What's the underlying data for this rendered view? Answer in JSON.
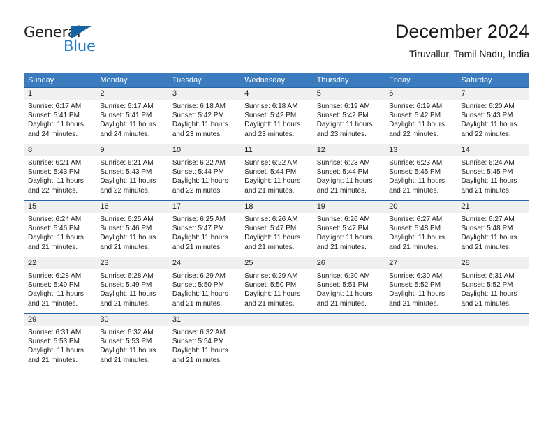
{
  "brand": {
    "name_top": "General",
    "name_bottom": "Blue",
    "triangle_color": "#1464a5",
    "blue_text_color": "#1f7ac4"
  },
  "header": {
    "title": "December 2024",
    "subtitle": "Tiruvallur, Tamil Nadu, India"
  },
  "theme": {
    "header_bg": "#3a7cbe",
    "header_text": "#ffffff",
    "week_rule": "#2166ab",
    "number_strip_bg": "#f0f0f0",
    "page_bg": "#ffffff",
    "text": "#1a1a1a"
  },
  "weekdays": [
    "Sunday",
    "Monday",
    "Tuesday",
    "Wednesday",
    "Thursday",
    "Friday",
    "Saturday"
  ],
  "labels": {
    "sunrise_prefix": "Sunrise:",
    "sunset_prefix": "Sunset:",
    "daylight_prefix": "Daylight:"
  },
  "weeks": [
    {
      "days": [
        {
          "num": "1",
          "sunrise": "Sunrise: 6:17 AM",
          "sunset": "Sunset: 5:41 PM",
          "daylight1": "Daylight: 11 hours",
          "daylight2": "and 24 minutes."
        },
        {
          "num": "2",
          "sunrise": "Sunrise: 6:17 AM",
          "sunset": "Sunset: 5:41 PM",
          "daylight1": "Daylight: 11 hours",
          "daylight2": "and 24 minutes."
        },
        {
          "num": "3",
          "sunrise": "Sunrise: 6:18 AM",
          "sunset": "Sunset: 5:42 PM",
          "daylight1": "Daylight: 11 hours",
          "daylight2": "and 23 minutes."
        },
        {
          "num": "4",
          "sunrise": "Sunrise: 6:18 AM",
          "sunset": "Sunset: 5:42 PM",
          "daylight1": "Daylight: 11 hours",
          "daylight2": "and 23 minutes."
        },
        {
          "num": "5",
          "sunrise": "Sunrise: 6:19 AM",
          "sunset": "Sunset: 5:42 PM",
          "daylight1": "Daylight: 11 hours",
          "daylight2": "and 23 minutes."
        },
        {
          "num": "6",
          "sunrise": "Sunrise: 6:19 AM",
          "sunset": "Sunset: 5:42 PM",
          "daylight1": "Daylight: 11 hours",
          "daylight2": "and 22 minutes."
        },
        {
          "num": "7",
          "sunrise": "Sunrise: 6:20 AM",
          "sunset": "Sunset: 5:43 PM",
          "daylight1": "Daylight: 11 hours",
          "daylight2": "and 22 minutes."
        }
      ]
    },
    {
      "days": [
        {
          "num": "8",
          "sunrise": "Sunrise: 6:21 AM",
          "sunset": "Sunset: 5:43 PM",
          "daylight1": "Daylight: 11 hours",
          "daylight2": "and 22 minutes."
        },
        {
          "num": "9",
          "sunrise": "Sunrise: 6:21 AM",
          "sunset": "Sunset: 5:43 PM",
          "daylight1": "Daylight: 11 hours",
          "daylight2": "and 22 minutes."
        },
        {
          "num": "10",
          "sunrise": "Sunrise: 6:22 AM",
          "sunset": "Sunset: 5:44 PM",
          "daylight1": "Daylight: 11 hours",
          "daylight2": "and 22 minutes."
        },
        {
          "num": "11",
          "sunrise": "Sunrise: 6:22 AM",
          "sunset": "Sunset: 5:44 PM",
          "daylight1": "Daylight: 11 hours",
          "daylight2": "and 21 minutes."
        },
        {
          "num": "12",
          "sunrise": "Sunrise: 6:23 AM",
          "sunset": "Sunset: 5:44 PM",
          "daylight1": "Daylight: 11 hours",
          "daylight2": "and 21 minutes."
        },
        {
          "num": "13",
          "sunrise": "Sunrise: 6:23 AM",
          "sunset": "Sunset: 5:45 PM",
          "daylight1": "Daylight: 11 hours",
          "daylight2": "and 21 minutes."
        },
        {
          "num": "14",
          "sunrise": "Sunrise: 6:24 AM",
          "sunset": "Sunset: 5:45 PM",
          "daylight1": "Daylight: 11 hours",
          "daylight2": "and 21 minutes."
        }
      ]
    },
    {
      "days": [
        {
          "num": "15",
          "sunrise": "Sunrise: 6:24 AM",
          "sunset": "Sunset: 5:46 PM",
          "daylight1": "Daylight: 11 hours",
          "daylight2": "and 21 minutes."
        },
        {
          "num": "16",
          "sunrise": "Sunrise: 6:25 AM",
          "sunset": "Sunset: 5:46 PM",
          "daylight1": "Daylight: 11 hours",
          "daylight2": "and 21 minutes."
        },
        {
          "num": "17",
          "sunrise": "Sunrise: 6:25 AM",
          "sunset": "Sunset: 5:47 PM",
          "daylight1": "Daylight: 11 hours",
          "daylight2": "and 21 minutes."
        },
        {
          "num": "18",
          "sunrise": "Sunrise: 6:26 AM",
          "sunset": "Sunset: 5:47 PM",
          "daylight1": "Daylight: 11 hours",
          "daylight2": "and 21 minutes."
        },
        {
          "num": "19",
          "sunrise": "Sunrise: 6:26 AM",
          "sunset": "Sunset: 5:47 PM",
          "daylight1": "Daylight: 11 hours",
          "daylight2": "and 21 minutes."
        },
        {
          "num": "20",
          "sunrise": "Sunrise: 6:27 AM",
          "sunset": "Sunset: 5:48 PM",
          "daylight1": "Daylight: 11 hours",
          "daylight2": "and 21 minutes."
        },
        {
          "num": "21",
          "sunrise": "Sunrise: 6:27 AM",
          "sunset": "Sunset: 5:48 PM",
          "daylight1": "Daylight: 11 hours",
          "daylight2": "and 21 minutes."
        }
      ]
    },
    {
      "days": [
        {
          "num": "22",
          "sunrise": "Sunrise: 6:28 AM",
          "sunset": "Sunset: 5:49 PM",
          "daylight1": "Daylight: 11 hours",
          "daylight2": "and 21 minutes."
        },
        {
          "num": "23",
          "sunrise": "Sunrise: 6:28 AM",
          "sunset": "Sunset: 5:49 PM",
          "daylight1": "Daylight: 11 hours",
          "daylight2": "and 21 minutes."
        },
        {
          "num": "24",
          "sunrise": "Sunrise: 6:29 AM",
          "sunset": "Sunset: 5:50 PM",
          "daylight1": "Daylight: 11 hours",
          "daylight2": "and 21 minutes."
        },
        {
          "num": "25",
          "sunrise": "Sunrise: 6:29 AM",
          "sunset": "Sunset: 5:50 PM",
          "daylight1": "Daylight: 11 hours",
          "daylight2": "and 21 minutes."
        },
        {
          "num": "26",
          "sunrise": "Sunrise: 6:30 AM",
          "sunset": "Sunset: 5:51 PM",
          "daylight1": "Daylight: 11 hours",
          "daylight2": "and 21 minutes."
        },
        {
          "num": "27",
          "sunrise": "Sunrise: 6:30 AM",
          "sunset": "Sunset: 5:52 PM",
          "daylight1": "Daylight: 11 hours",
          "daylight2": "and 21 minutes."
        },
        {
          "num": "28",
          "sunrise": "Sunrise: 6:31 AM",
          "sunset": "Sunset: 5:52 PM",
          "daylight1": "Daylight: 11 hours",
          "daylight2": "and 21 minutes."
        }
      ]
    },
    {
      "days": [
        {
          "num": "29",
          "sunrise": "Sunrise: 6:31 AM",
          "sunset": "Sunset: 5:53 PM",
          "daylight1": "Daylight: 11 hours",
          "daylight2": "and 21 minutes."
        },
        {
          "num": "30",
          "sunrise": "Sunrise: 6:32 AM",
          "sunset": "Sunset: 5:53 PM",
          "daylight1": "Daylight: 11 hours",
          "daylight2": "and 21 minutes."
        },
        {
          "num": "31",
          "sunrise": "Sunrise: 6:32 AM",
          "sunset": "Sunset: 5:54 PM",
          "daylight1": "Daylight: 11 hours",
          "daylight2": "and 21 minutes."
        },
        {
          "num": "",
          "sunrise": "",
          "sunset": "",
          "daylight1": "",
          "daylight2": ""
        },
        {
          "num": "",
          "sunrise": "",
          "sunset": "",
          "daylight1": "",
          "daylight2": ""
        },
        {
          "num": "",
          "sunrise": "",
          "sunset": "",
          "daylight1": "",
          "daylight2": ""
        },
        {
          "num": "",
          "sunrise": "",
          "sunset": "",
          "daylight1": "",
          "daylight2": ""
        }
      ]
    }
  ]
}
